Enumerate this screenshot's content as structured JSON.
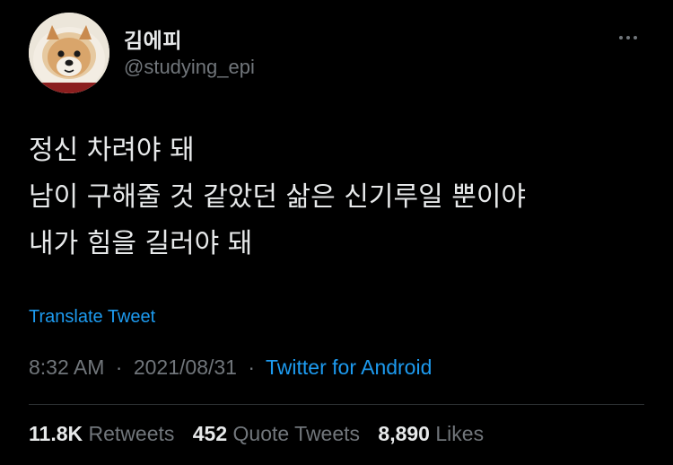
{
  "user": {
    "display_name": "김에피",
    "handle": "@studying_epi",
    "avatar_icon": "pomeranian-dog-avatar"
  },
  "tweet": {
    "lines": [
      "정신 차려야 돼",
      "남이 구해줄 것 같았던 삶은 신기루일 뿐이야",
      "내가 힘을 길러야 돼"
    ],
    "translate_label": "Translate Tweet"
  },
  "meta": {
    "time": "8:32 AM",
    "separator": "·",
    "date": "2021/08/31",
    "source": "Twitter for Android"
  },
  "stats": {
    "retweets": {
      "count": "11.8K",
      "label": "Retweets"
    },
    "quotes": {
      "count": "452",
      "label": "Quote Tweets"
    },
    "likes": {
      "count": "8,890",
      "label": "Likes"
    }
  },
  "colors": {
    "background": "#000000",
    "text": "#e7e9ea",
    "muted": "#71767b",
    "link": "#1d9bf0",
    "divider": "#2f3336"
  },
  "icons": {
    "more": "more-horizontal-icon"
  }
}
